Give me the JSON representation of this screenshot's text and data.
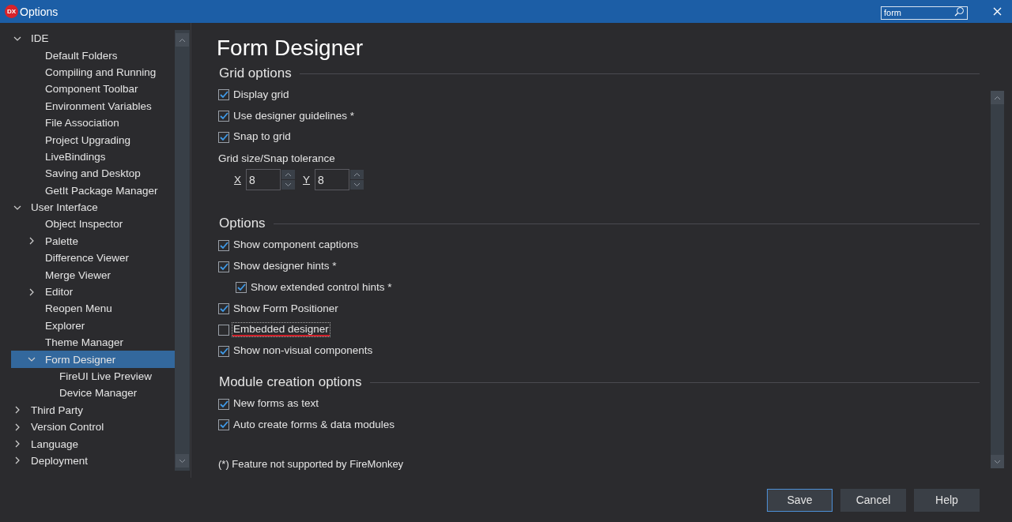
{
  "window": {
    "logo": "DX",
    "title": "Options",
    "search": {
      "value": "form"
    }
  },
  "tree": [
    {
      "label": "IDE",
      "expanded": true,
      "selected": false,
      "children": [
        {
          "label": "Default Folders",
          "selected": false
        },
        {
          "label": "Compiling and Running",
          "selected": false
        },
        {
          "label": "Component Toolbar",
          "selected": false
        },
        {
          "label": "Environment Variables",
          "selected": false
        },
        {
          "label": "File Association",
          "selected": false
        },
        {
          "label": "Project Upgrading",
          "selected": false
        },
        {
          "label": "LiveBindings",
          "selected": false
        },
        {
          "label": "Saving and Desktop",
          "selected": false
        },
        {
          "label": "GetIt Package Manager",
          "selected": false
        }
      ]
    },
    {
      "label": "User Interface",
      "expanded": true,
      "selected": false,
      "children": [
        {
          "label": "Object Inspector",
          "selected": false
        },
        {
          "label": "Palette",
          "expanded": false,
          "selected": false
        },
        {
          "label": "Difference Viewer",
          "selected": false
        },
        {
          "label": "Merge Viewer",
          "selected": false
        },
        {
          "label": "Editor",
          "expanded": false,
          "selected": false
        },
        {
          "label": "Reopen Menu",
          "selected": false
        },
        {
          "label": "Explorer",
          "selected": false
        },
        {
          "label": "Theme Manager",
          "selected": false
        },
        {
          "label": "Form Designer",
          "expanded": true,
          "selected": true,
          "children": [
            {
              "label": "FireUI Live Preview",
              "selected": false
            },
            {
              "label": "Device Manager",
              "selected": false
            }
          ]
        }
      ]
    },
    {
      "label": "Third Party",
      "expanded": false,
      "selected": false
    },
    {
      "label": "Version Control",
      "expanded": false,
      "selected": false
    },
    {
      "label": "Language",
      "expanded": false,
      "selected": false
    },
    {
      "label": "Deployment",
      "expanded": false,
      "selected": false
    }
  ],
  "page": {
    "title": "Form Designer",
    "grid_options": {
      "heading": "Grid options",
      "checkboxes": [
        {
          "label": "Display grid",
          "checked": true,
          "focused": false,
          "highlighted": false
        },
        {
          "label": "Use designer guidelines *",
          "checked": true,
          "focused": false,
          "highlighted": false
        },
        {
          "label": "Snap to grid",
          "checked": true,
          "focused": false,
          "highlighted": false
        }
      ],
      "size_label": "Grid size/Snap tolerance",
      "fields": [
        {
          "label": "X",
          "value": "8"
        },
        {
          "label": "Y",
          "value": "8"
        }
      ]
    },
    "options": {
      "heading": "Options",
      "checkboxes": [
        {
          "label": "Show component captions",
          "checked": true,
          "focused": false,
          "highlighted": false
        },
        {
          "label": "Show designer hints *",
          "checked": true,
          "focused": false,
          "highlighted": false,
          "children": [
            {
              "label": "Show extended control hints *",
              "checked": true,
              "focused": false,
              "highlighted": false
            }
          ]
        },
        {
          "label": "Show Form Positioner",
          "checked": true,
          "focused": false,
          "highlighted": false
        },
        {
          "label": "Embedded designer",
          "checked": false,
          "focused": true,
          "highlighted": true
        },
        {
          "label": "Show non-visual components",
          "checked": true,
          "focused": false,
          "highlighted": false
        }
      ]
    },
    "module": {
      "heading": "Module creation options",
      "checkboxes": [
        {
          "label": "New forms as text",
          "checked": true,
          "focused": false,
          "highlighted": false
        },
        {
          "label": "Auto create forms & data modules",
          "checked": true,
          "focused": false,
          "highlighted": false
        }
      ]
    },
    "footnote": "(*) Feature not supported by FireMonkey"
  },
  "buttons": [
    {
      "label": "Save",
      "default": true
    },
    {
      "label": "Cancel",
      "default": false
    },
    {
      "label": "Help",
      "default": false
    }
  ]
}
